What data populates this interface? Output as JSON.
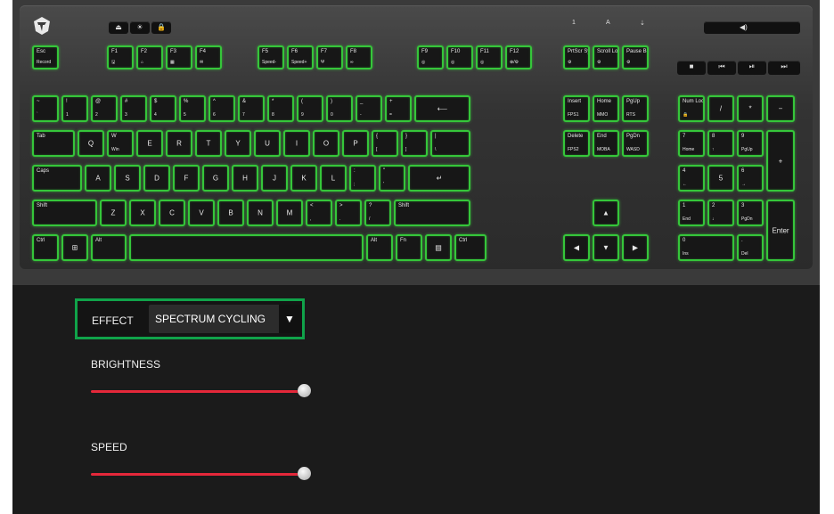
{
  "media": {
    "labels": [
      "⏏",
      "☀",
      "🔒"
    ]
  },
  "indicators": [
    "1",
    "A",
    "⇣"
  ],
  "volume": {
    "icon": "speaker-icon"
  },
  "keys": {
    "esc": [
      "Esc",
      "Record"
    ],
    "f1": [
      "F1",
      "🖫"
    ],
    "f2": [
      "F2",
      "⌂"
    ],
    "f3": [
      "F3",
      "▦"
    ],
    "f4": [
      "F4",
      "✉"
    ],
    "f5": [
      "F5",
      "Speed-"
    ],
    "f6": [
      "F6",
      "Speed+"
    ],
    "f7": [
      "F7",
      "Ψ"
    ],
    "f8": [
      "F8",
      "∞"
    ],
    "f9": [
      "F9",
      "◎"
    ],
    "f10": [
      "F10",
      "◎"
    ],
    "f11": [
      "F11",
      "◎"
    ],
    "f12": [
      "F12",
      "⊕/⚙"
    ],
    "prtscr": [
      "PrtScr SysRq",
      "⚙"
    ],
    "scroll": [
      "Scroll Lock",
      "⚙"
    ],
    "pause": [
      "Pause Break",
      "⚙"
    ],
    "tilde": [
      "~",
      "`"
    ],
    "k1": [
      "!",
      "1"
    ],
    "k2": [
      "@",
      "2"
    ],
    "k3": [
      "#",
      "3"
    ],
    "k4": [
      "$",
      "4"
    ],
    "k5": [
      "%",
      "5"
    ],
    "k6": [
      "^",
      "6"
    ],
    "k7": [
      "&",
      "7"
    ],
    "k8": [
      "*",
      "8"
    ],
    "k9": [
      "(",
      "9"
    ],
    "k0": [
      ")",
      "0"
    ],
    "minus": [
      "_",
      "-"
    ],
    "equal": [
      "+",
      "="
    ],
    "backspace": [
      "⟵"
    ],
    "insert": [
      "Insert",
      "FPS1"
    ],
    "home": [
      "Home",
      "MMO"
    ],
    "pgup": [
      "PgUp",
      "RTS"
    ],
    "numlock": [
      "Num Lock",
      "🔒"
    ],
    "numslash": [
      "/"
    ],
    "numstar": [
      "*"
    ],
    "numminus": [
      "−"
    ],
    "tab": [
      "Tab"
    ],
    "q": [
      "Q"
    ],
    "w": [
      "W",
      "Win"
    ],
    "e": [
      "E"
    ],
    "r": [
      "R"
    ],
    "t": [
      "T"
    ],
    "y": [
      "Y"
    ],
    "u": [
      "U"
    ],
    "i": [
      "I"
    ],
    "o": [
      "O"
    ],
    "p": [
      "P"
    ],
    "lbrace": [
      "{",
      "["
    ],
    "rbrace": [
      "}",
      "]"
    ],
    "pipe": [
      "|",
      "\\"
    ],
    "delete": [
      "Delete",
      "FPS2"
    ],
    "end": [
      "End",
      "MOBA"
    ],
    "pgdn": [
      "PgDn",
      "WASD"
    ],
    "num7": [
      "7",
      "Home"
    ],
    "num8": [
      "8",
      "↑"
    ],
    "num9": [
      "9",
      "PgUp"
    ],
    "numplus": [
      "+"
    ],
    "caps": [
      "Caps"
    ],
    "a": [
      "A"
    ],
    "s": [
      "S"
    ],
    "d": [
      "D"
    ],
    "f": [
      "F"
    ],
    "g": [
      "G"
    ],
    "h": [
      "H"
    ],
    "j": [
      "J"
    ],
    "k": [
      "K"
    ],
    "l": [
      "L"
    ],
    "colon": [
      ":",
      ";"
    ],
    "quote": [
      "\"",
      "'"
    ],
    "enter": [
      "↵"
    ],
    "num4": [
      "4",
      "←"
    ],
    "num5": [
      "5"
    ],
    "num6": [
      "6",
      "→"
    ],
    "lshift": [
      "Shift"
    ],
    "z": [
      "Z"
    ],
    "x": [
      "X"
    ],
    "cc": [
      "C"
    ],
    "v": [
      "V"
    ],
    "b": [
      "B"
    ],
    "n": [
      "N"
    ],
    "m": [
      "M"
    ],
    "comma": [
      "<",
      ","
    ],
    "period": [
      ">",
      "."
    ],
    "slash": [
      "?",
      "/"
    ],
    "rshift": [
      "Shift"
    ],
    "up": [
      "▲"
    ],
    "num1": [
      "1",
      "End"
    ],
    "num2": [
      "2",
      "↓"
    ],
    "num3": [
      "3",
      "PgDn"
    ],
    "numenter": [
      "Enter"
    ],
    "lctrl": [
      "Ctrl"
    ],
    "win": [
      "⊞"
    ],
    "lalt": [
      "Alt"
    ],
    "space": [
      ""
    ],
    "ralt": [
      "Alt"
    ],
    "fn": [
      "Fn"
    ],
    "menu": [
      "▤"
    ],
    "rctrl": [
      "Ctrl"
    ],
    "left": [
      "◀"
    ],
    "down": [
      "▼"
    ],
    "right": [
      "▶"
    ],
    "num0": [
      "0",
      "Ins"
    ],
    "numdot": [
      ".",
      "Del"
    ]
  },
  "settings": {
    "effect_label": "EFFECT",
    "effect_value": "SPECTRUM CYCLING",
    "effect_arrow": "▼",
    "brightness_label": "BRIGHTNESS",
    "brightness_value": 1.0,
    "speed_label": "SPEED",
    "speed_value": 1.0
  },
  "colors": {
    "key_glow": "#35c63a",
    "effect_border": "#10a34a",
    "slider_track": "#e5283a"
  }
}
